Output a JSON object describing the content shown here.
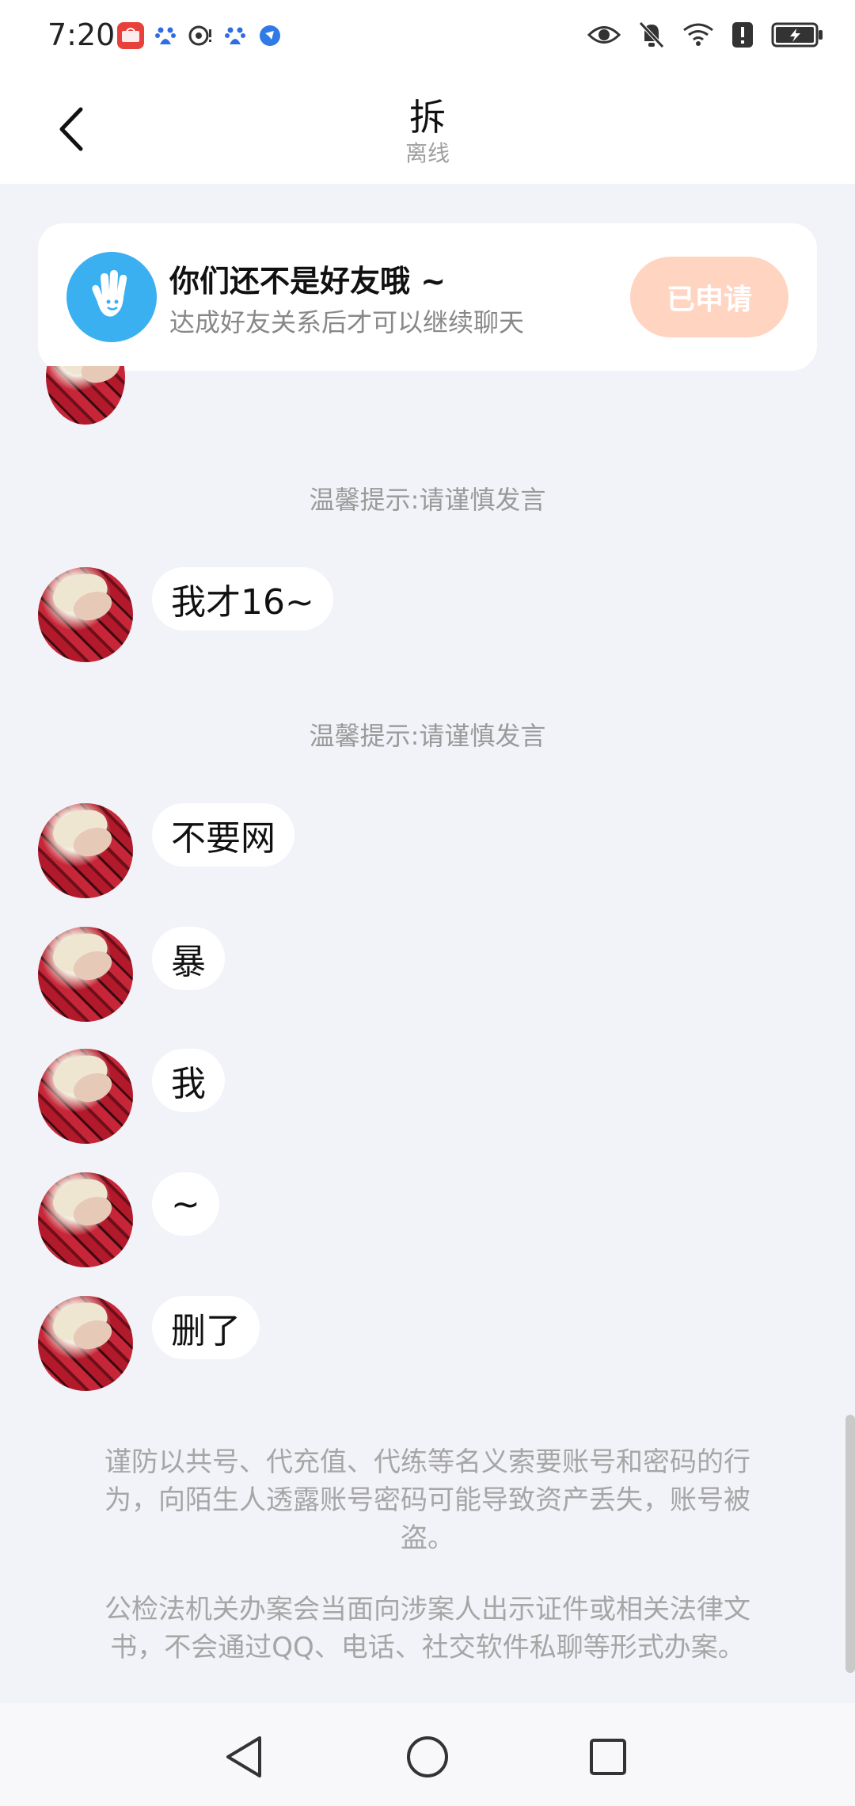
{
  "status_bar": {
    "time": "7:20",
    "left_icons": [
      "huawei-appgallery-icon",
      "baidu-icon",
      "nfc-icon",
      "baidu-icon",
      "browser-icon"
    ],
    "right_icons": [
      "eye-icon",
      "bell-off-icon",
      "wifi-icon",
      "alert-icon",
      "battery-charging-icon"
    ]
  },
  "header": {
    "back_icon": "back-arrow-icon",
    "title": "拆",
    "status": "离线"
  },
  "friend_banner": {
    "title": "你们还不是好友哦 ~",
    "subtitle": "达成好友关系后才可以继续聊天",
    "button_label": "已申请",
    "button_color": "#ffd5c2",
    "icon_color": "#3bb0f0"
  },
  "tips": {
    "tip1": "温馨提示:请谨慎发言",
    "tip2": "温馨提示:请谨慎发言"
  },
  "messages": [
    {
      "text": "我才16~"
    },
    {
      "text": "不要网"
    },
    {
      "text": "暴"
    },
    {
      "text": "我"
    },
    {
      "text": "~"
    },
    {
      "text": "删了"
    }
  ],
  "notices": {
    "notice1": "谨防以共号、代充值、代练等名义索要账号和密码的行为，向陌生人透露账号密码可能导致资产丢失，账号被盗。",
    "notice2": "公检法机关办案会当面向涉案人出示证件或相关法律文书，不会通过QQ、电话、社交软件私聊等形式办案。"
  },
  "nav_bar": {
    "back": "nav-back-icon",
    "home": "nav-home-icon",
    "recents": "nav-recents-icon"
  }
}
